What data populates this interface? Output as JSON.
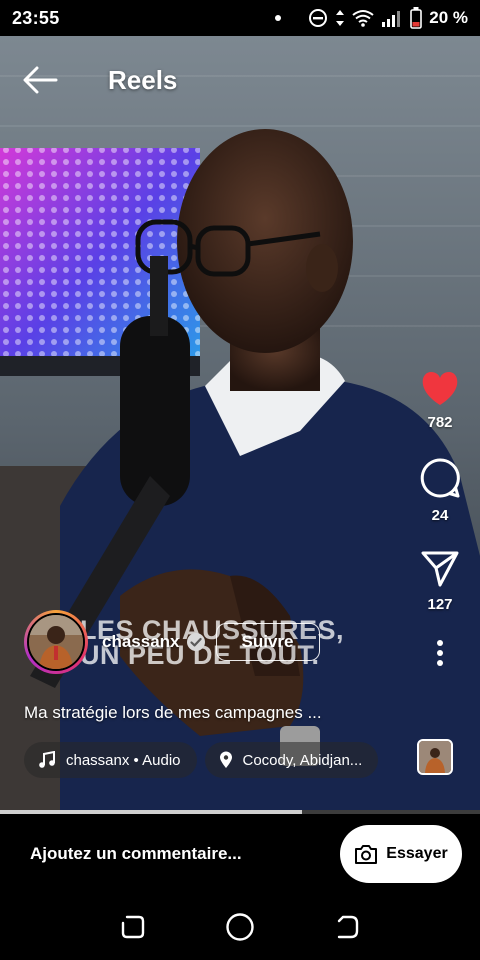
{
  "status_bar": {
    "time": "23:55",
    "battery": "20 %"
  },
  "header": {
    "title": "Reels"
  },
  "video": {
    "overlay_text_line1": "LES CHAUSSURES,",
    "overlay_text_line2": "UN PEU DE TOUT."
  },
  "actions": {
    "likes": "782",
    "comments": "24",
    "shares": "127"
  },
  "author": {
    "username": "chassanx",
    "follow_label": "Suivre"
  },
  "description": "Ma stratégie lors de mes campagnes ...",
  "chips": {
    "audio": "chassanx • Audio",
    "location": "Cocody, Abidjan..."
  },
  "playback": {
    "progress_fraction": 0.63
  },
  "comment_bar": {
    "placeholder": "Ajoutez un commentaire...",
    "try_label": "Essayer"
  },
  "colors": {
    "like": "#f0363e",
    "avatar_ring": [
      "#f6a23a",
      "#e2326b",
      "#b32fc6"
    ]
  }
}
